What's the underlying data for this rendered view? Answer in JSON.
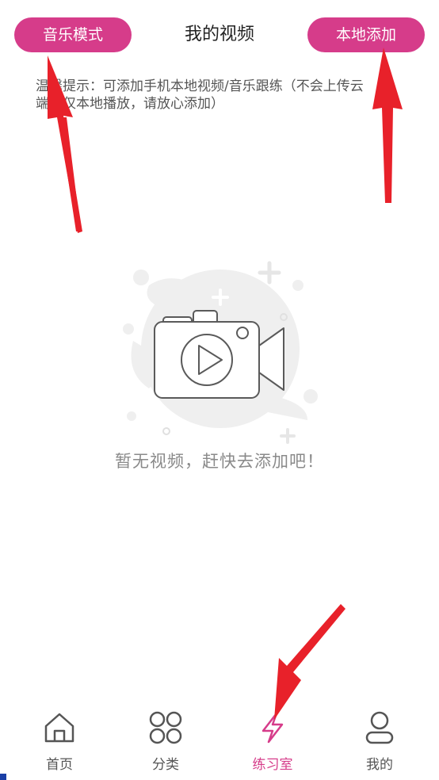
{
  "header": {
    "left_button_label": "音乐模式",
    "title": "我的视频",
    "right_button_label": "本地添加"
  },
  "tip": {
    "text": "温馨提示：可添加手机本地视频/音乐跟练（不会上传云端，仅本地播放，请放心添加）"
  },
  "empty_state": {
    "illustration_icon": "camera-play-icon",
    "message": "暂无视频，赶快去添加吧！"
  },
  "bottom_nav": {
    "items": [
      {
        "label": "首页",
        "icon": "home-icon",
        "active": false
      },
      {
        "label": "分类",
        "icon": "grid-icon",
        "active": false
      },
      {
        "label": "练习室",
        "icon": "lightning-icon",
        "active": true
      },
      {
        "label": "我的",
        "icon": "user-icon",
        "active": false
      }
    ]
  },
  "colors": {
    "accent": "#d63c8a",
    "arrow": "#e8212a",
    "illustration_bg": "#efefef",
    "icon_stroke": "#5a5a5a"
  }
}
